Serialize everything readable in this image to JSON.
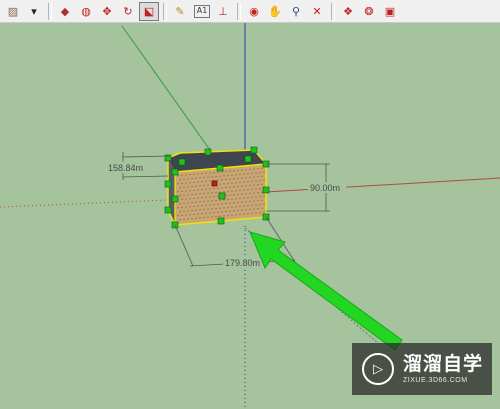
{
  "toolbar": {
    "buttons": [
      {
        "name": "material-swatch",
        "glyph": "▨",
        "color": "#8b6b4a"
      },
      {
        "name": "dropdown-arrow",
        "glyph": "▾",
        "color": "#222222"
      },
      {
        "name": "push-pull",
        "glyph": "◆",
        "color": "#b03030"
      },
      {
        "name": "follow-me",
        "glyph": "◍",
        "color": "#c02020"
      },
      {
        "name": "move",
        "glyph": "✥",
        "color": "#c02020"
      },
      {
        "name": "rotate",
        "glyph": "↻",
        "color": "#c02020"
      },
      {
        "name": "scale",
        "glyph": "⬕",
        "color": "#c02020",
        "active": true
      },
      {
        "name": "tape-measure",
        "glyph": "✎",
        "color": "#b08a20"
      },
      {
        "name": "text",
        "glyph": "A1",
        "color": "#333333"
      },
      {
        "name": "axes",
        "glyph": "⊥",
        "color": "#c02020"
      },
      {
        "name": "orbit",
        "glyph": "◉",
        "color": "#c02020"
      },
      {
        "name": "pan",
        "glyph": "✋",
        "color": "#b08a20"
      },
      {
        "name": "zoom",
        "glyph": "⚲",
        "color": "#2a4a7a"
      },
      {
        "name": "zoom-extents",
        "glyph": "✕",
        "color": "#c02020"
      },
      {
        "name": "components",
        "glyph": "❖",
        "color": "#c02020"
      },
      {
        "name": "materials",
        "glyph": "❂",
        "color": "#c02020"
      },
      {
        "name": "styles",
        "glyph": "▣",
        "color": "#c02020"
      }
    ]
  },
  "dimensions": {
    "depth": "158.84m",
    "height": "90.00m",
    "width": "179.80m"
  },
  "colors": {
    "background": "#a5c39d",
    "red_axis": "#b54a3c",
    "green_axis": "#3c9a3c",
    "blue_axis": "#2a3aa8",
    "selection": "#f2e400",
    "grip": "#1ec31e",
    "arrow": "#22d622",
    "face": "#c8a574",
    "top_face": "#3e4450"
  },
  "watermark": {
    "logo_glyph": "▷",
    "text": "溜溜自学",
    "url": "ZIXUE.3D66.COM"
  }
}
